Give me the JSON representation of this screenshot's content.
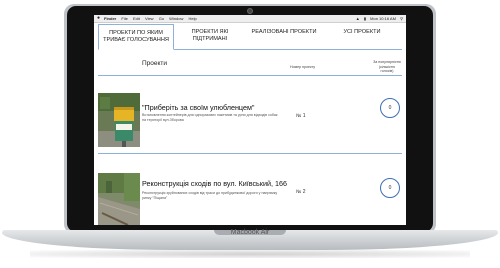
{
  "device": {
    "brand_label": "Macbook Air"
  },
  "menubar": {
    "app": "Finder",
    "menus": [
      "File",
      "Edit",
      "View",
      "Go",
      "Window",
      "Help"
    ],
    "clock": "Mon 10:16 AM"
  },
  "tabs": [
    {
      "label": "ПРОЕКТИ ПО ЯКИМ ТРИВАЄ ГОЛОСУВАННЯ",
      "active": true
    },
    {
      "label": "ПРОЕКТИ ЯКІ ПІДТРИМАНІ",
      "active": false
    },
    {
      "label": "РЕАЛІЗОВАНІ ПРОЕКТИ",
      "active": false
    },
    {
      "label": "УСІ ПРОЕКТИ",
      "active": false
    }
  ],
  "table": {
    "col_title": "Проекти",
    "col_num": "Номер проекту",
    "col_votes": "За популярністю (кількістю голосів)"
  },
  "projects": [
    {
      "title": "\"Приберіть за своїм улюбленцем\"",
      "description": "Встановлення контейнерів для одноразових пакетиків та урни для відходів собак на території вул.Зборова",
      "number": "№ 1",
      "votes": "0"
    },
    {
      "title": "Реконструкція сходів по вул. Київський, 166",
      "description": "Реконструкція зруйнованих сходів від траси до прибудинкової дороги у напрямку ринку \"Піщана\"",
      "number": "№ 2",
      "votes": "0"
    }
  ]
}
